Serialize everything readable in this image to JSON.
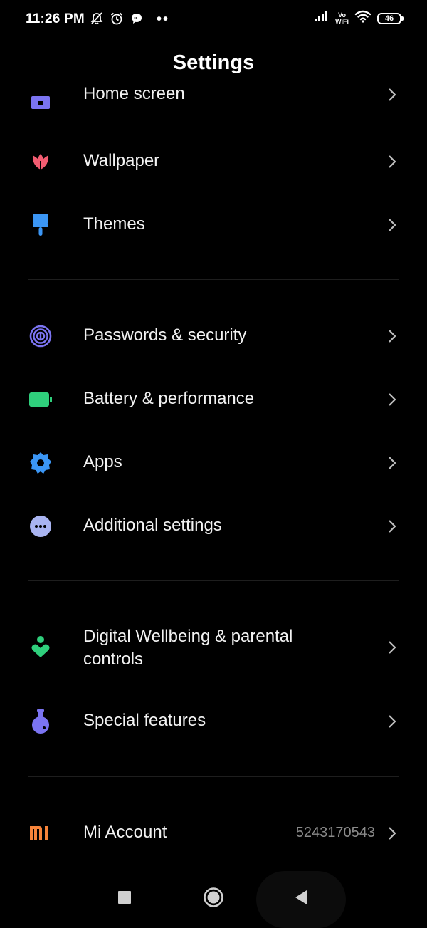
{
  "status_bar": {
    "time": "11:26 PM",
    "icons_left": [
      "muted-bell-icon",
      "alarm-icon",
      "chat-bubble-icon"
    ],
    "more_dots": "••",
    "network": {
      "signal_icon": "cellular-signal-icon",
      "vowifi_line1": "Vo",
      "vowifi_line2": "WiFi",
      "wifi_icon": "wifi-icon"
    },
    "battery_level": "46"
  },
  "header": {
    "title": "Settings"
  },
  "settings": {
    "groups": [
      {
        "items": [
          {
            "label": "Home screen",
            "icon": "home-screen-icon",
            "color": "#7b74f2"
          },
          {
            "label": "Wallpaper",
            "icon": "tulip-icon",
            "color": "#f25c71"
          },
          {
            "label": "Themes",
            "icon": "paint-brush-icon",
            "color": "#3b96f5"
          }
        ]
      },
      {
        "items": [
          {
            "label": "Passwords & security",
            "icon": "fingerprint-icon",
            "color": "#7b74f2"
          },
          {
            "label": "Battery & performance",
            "icon": "battery-icon",
            "color": "#2fcf7c"
          },
          {
            "label": "Apps",
            "icon": "gear-icon",
            "color": "#3b96f5"
          },
          {
            "label": "Additional settings",
            "icon": "more-dots-icon",
            "color": "#a9b4f1"
          }
        ]
      },
      {
        "items": [
          {
            "label_line1": "Digital Wellbeing & parental",
            "label_line2": "controls",
            "icon": "wellbeing-heart-icon",
            "color": "#2fcf7c"
          },
          {
            "label": "Special features",
            "icon": "flask-icon",
            "color": "#7b74f2"
          }
        ]
      },
      {
        "items": [
          {
            "label": "Mi Account",
            "value": "5243170543",
            "icon": "mi-logo-icon",
            "color": "#f7843a"
          }
        ]
      }
    ]
  },
  "navigation": {
    "buttons": [
      "recents-square-icon",
      "home-circle-icon",
      "back-triangle-icon"
    ]
  }
}
